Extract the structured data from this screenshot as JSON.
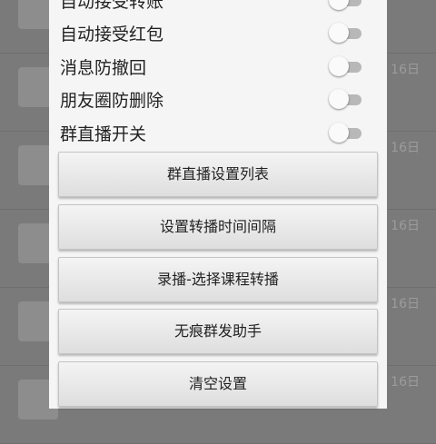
{
  "background_list": {
    "rows": [
      {
        "date": ""
      },
      {
        "date": "16日"
      },
      {
        "date": "16日"
      },
      {
        "date": "16日"
      },
      {
        "date": "16日"
      },
      {
        "date": "16日"
      }
    ]
  },
  "settings_dialog": {
    "switches": [
      {
        "label": "自动接受转账",
        "on": false
      },
      {
        "label": "自动接受红包",
        "on": false
      },
      {
        "label": "消息防撤回",
        "on": false
      },
      {
        "label": "朋友圈防删除",
        "on": false
      },
      {
        "label": "群直播开关",
        "on": false
      }
    ],
    "buttons": [
      {
        "label": "群直播设置列表"
      },
      {
        "label": "设置转播时间间隔"
      },
      {
        "label": "录播-选择课程转播"
      },
      {
        "label": "无痕群发助手"
      },
      {
        "label": "清空设置"
      }
    ]
  }
}
